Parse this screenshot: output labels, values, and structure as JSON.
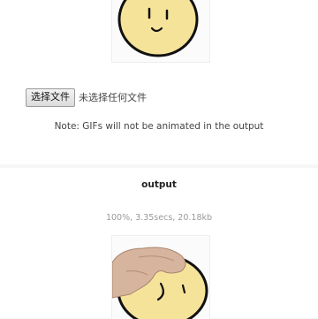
{
  "input": {
    "choose_file_label": "选择文件",
    "file_status": "未选择任何文件",
    "image_icon": "smiley-face-drawing"
  },
  "note": "Note: GIFs will not be animated in the output",
  "output": {
    "title": "output",
    "stats": "100%, 3.35secs, 20.18kb",
    "image_icon": "hand-holding-smiley-drawing"
  }
}
